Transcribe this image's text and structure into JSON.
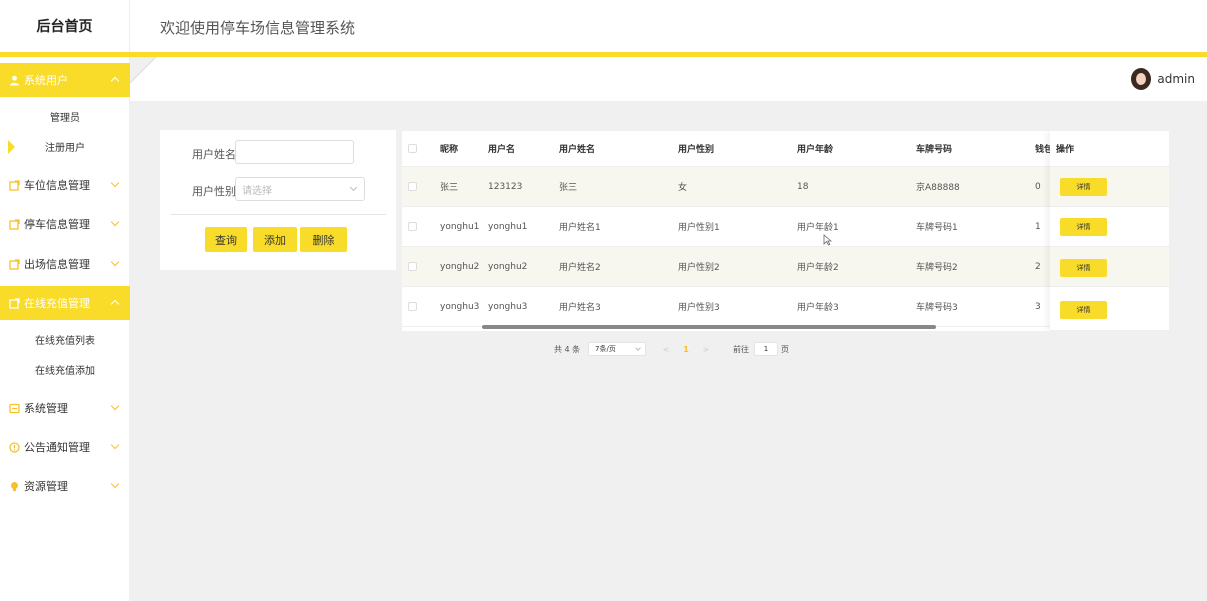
{
  "header": {
    "brand": "后台首页",
    "title": "欢迎使用停车场信息管理系统",
    "username": "admin"
  },
  "colors": {
    "accent": "#f9dc2a"
  },
  "sidebar": {
    "items": [
      {
        "label": "系统用户",
        "icon": "user-icon",
        "active": true,
        "children": [
          "管理员",
          "注册用户"
        ]
      },
      {
        "label": "车位信息管理",
        "icon": "edit-icon"
      },
      {
        "label": "停车信息管理",
        "icon": "edit-icon"
      },
      {
        "label": "出场信息管理",
        "icon": "edit-icon"
      },
      {
        "label": "在线充值管理",
        "icon": "edit-icon",
        "active": true,
        "children": [
          "在线充值列表",
          "在线充值添加"
        ]
      },
      {
        "label": "系统管理",
        "icon": "monitor-icon"
      },
      {
        "label": "公告通知管理",
        "icon": "info-icon"
      },
      {
        "label": "资源管理",
        "icon": "bulb-icon"
      }
    ]
  },
  "search": {
    "name_label": "用户姓名",
    "name_value": "",
    "gender_label": "用户性别",
    "gender_placeholder": "请选择",
    "query_btn": "查询",
    "add_btn": "添加",
    "delete_btn": "删除"
  },
  "table": {
    "headers": [
      "昵称",
      "用户名",
      "用户姓名",
      "用户性别",
      "用户年龄",
      "车牌号码",
      "钱包",
      "操作"
    ],
    "rows": [
      {
        "nickname": "张三",
        "username": "123123",
        "realname": "张三",
        "gender": "女",
        "age": "18",
        "plate": "京A88888",
        "wallet": "0"
      },
      {
        "nickname": "yonghu1",
        "username": "yonghu1",
        "realname": "用户姓名1",
        "gender": "用户性别1",
        "age": "用户年龄1",
        "plate": "车牌号码1",
        "wallet": "1"
      },
      {
        "nickname": "yonghu2",
        "username": "yonghu2",
        "realname": "用户姓名2",
        "gender": "用户性别2",
        "age": "用户年龄2",
        "plate": "车牌号码2",
        "wallet": "2"
      },
      {
        "nickname": "yonghu3",
        "username": "yonghu3",
        "realname": "用户姓名3",
        "gender": "用户性别3",
        "age": "用户年龄3",
        "plate": "车牌号码3",
        "wallet": "3"
      }
    ],
    "detail_btn": "详情"
  },
  "pager": {
    "total": "共 4 条",
    "page_size": "7条/页",
    "prev": "<",
    "current": "1",
    "next": ">",
    "goto_prefix": "前往",
    "goto_value": "1",
    "goto_suffix": "页"
  }
}
